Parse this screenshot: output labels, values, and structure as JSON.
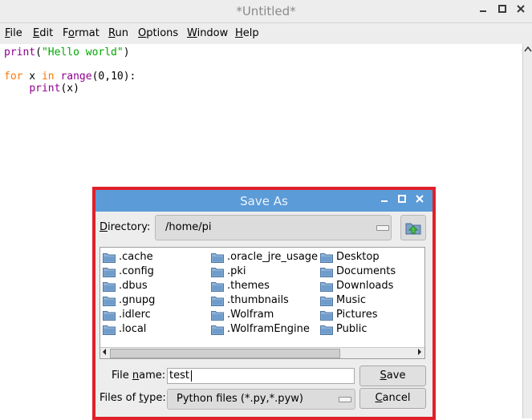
{
  "window": {
    "title": "*Untitled*",
    "controls": [
      "minimize-icon",
      "maximize-icon",
      "close-icon"
    ]
  },
  "menu": [
    {
      "mnemonic": "F",
      "rest": "ile"
    },
    {
      "mnemonic": "E",
      "rest": "dit"
    },
    {
      "mnemonic": "",
      "pre": "F",
      "ul": "o",
      "post": "rmat"
    },
    {
      "mnemonic": "R",
      "rest": "un"
    },
    {
      "mnemonic": "O",
      "rest": "ptions"
    },
    {
      "mnemonic": "W",
      "rest": "indow"
    },
    {
      "mnemonic": "H",
      "rest": "elp"
    }
  ],
  "editor": {
    "line1": {
      "fn": "print",
      "open": "(",
      "str": "\"Hello world\"",
      "close": ")"
    },
    "line3": {
      "kw1": "for",
      "var": " x ",
      "kw2": "in",
      "sp": " ",
      "fn": "range",
      "args": "(0,10):"
    },
    "line4": {
      "indent": "    ",
      "fn": "print",
      "args": "(x)"
    }
  },
  "dialog": {
    "title": "Save As",
    "directory_label_pre": "D",
    "directory_label_rest": "irectory:",
    "directory_value": "/home/pi",
    "up_button_icon": "folder-up-icon",
    "files": [
      ".cache",
      ".config",
      ".dbus",
      ".gnupg",
      ".idlerc",
      ".local",
      ".oracle_jre_usage",
      ".pki",
      ".themes",
      ".thumbnails",
      ".Wolfram",
      ".WolframEngine",
      "Desktop",
      "Documents",
      "Downloads",
      "Music",
      "Pictures",
      "Public"
    ],
    "file_name_label_pre": "File ",
    "file_name_label_ul": "n",
    "file_name_label_post": "ame:",
    "file_name_value": "test",
    "save_pre": "",
    "save_ul": "S",
    "save_post": "ave",
    "files_of_type_label_pre": "Files of ",
    "files_of_type_label_ul": "t",
    "files_of_type_label_post": "ype:",
    "files_of_type_value": "Python files (*.py,*.pyw)",
    "cancel_ul": "C",
    "cancel_post": "ancel"
  },
  "colors": {
    "dialog_title_bg": "#5b9bd8",
    "highlight_border": "#e0202a",
    "keyword": "#ff7700",
    "builtin": "#900090",
    "string": "#00aa00"
  }
}
